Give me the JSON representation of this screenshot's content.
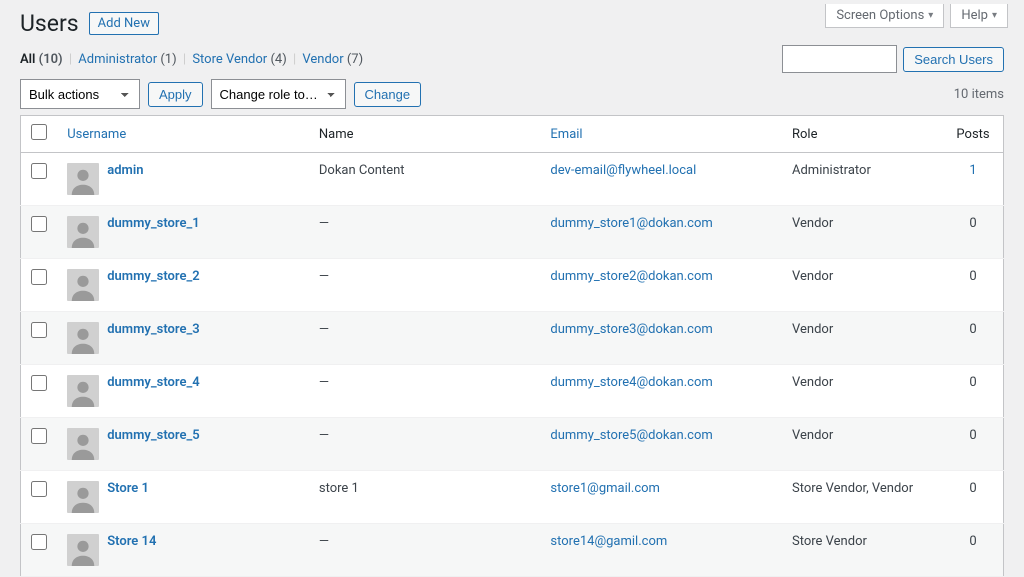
{
  "top": {
    "screen_options": "Screen Options",
    "help": "Help"
  },
  "header": {
    "title": "Users",
    "add_new": "Add New"
  },
  "filters": {
    "all_label": "All",
    "all_count": "(10)",
    "admin_label": "Administrator",
    "admin_count": "(1)",
    "vendor_label": "Store Vendor",
    "vendor_count": "(4)",
    "vendor2_label": "Vendor",
    "vendor2_count": "(7)"
  },
  "search": {
    "button": "Search Users"
  },
  "tablenav": {
    "bulk_placeholder": "Bulk actions",
    "apply": "Apply",
    "role_placeholder": "Change role to…",
    "change": "Change",
    "items": "10 items"
  },
  "columns": {
    "username": "Username",
    "name": "Name",
    "email": "Email",
    "role": "Role",
    "posts": "Posts"
  },
  "rows": [
    {
      "username": "admin",
      "name": "Dokan Content",
      "email": "dev-email@flywheel.local",
      "role": "Administrator",
      "posts": "1",
      "posts_link": true
    },
    {
      "username": "dummy_store_1",
      "name": "—",
      "email": "dummy_store1@dokan.com",
      "role": "Vendor",
      "posts": "0"
    },
    {
      "username": "dummy_store_2",
      "name": "—",
      "email": "dummy_store2@dokan.com",
      "role": "Vendor",
      "posts": "0"
    },
    {
      "username": "dummy_store_3",
      "name": "—",
      "email": "dummy_store3@dokan.com",
      "role": "Vendor",
      "posts": "0"
    },
    {
      "username": "dummy_store_4",
      "name": "—",
      "email": "dummy_store4@dokan.com",
      "role": "Vendor",
      "posts": "0"
    },
    {
      "username": "dummy_store_5",
      "name": "—",
      "email": "dummy_store5@dokan.com",
      "role": "Vendor",
      "posts": "0"
    },
    {
      "username": "Store 1",
      "name": "store 1",
      "email": "store1@gmail.com",
      "role": "Store Vendor, Vendor",
      "posts": "0"
    },
    {
      "username": "Store 14",
      "name": "—",
      "email": "store14@gamil.com",
      "role": "Store Vendor",
      "posts": "0"
    }
  ]
}
